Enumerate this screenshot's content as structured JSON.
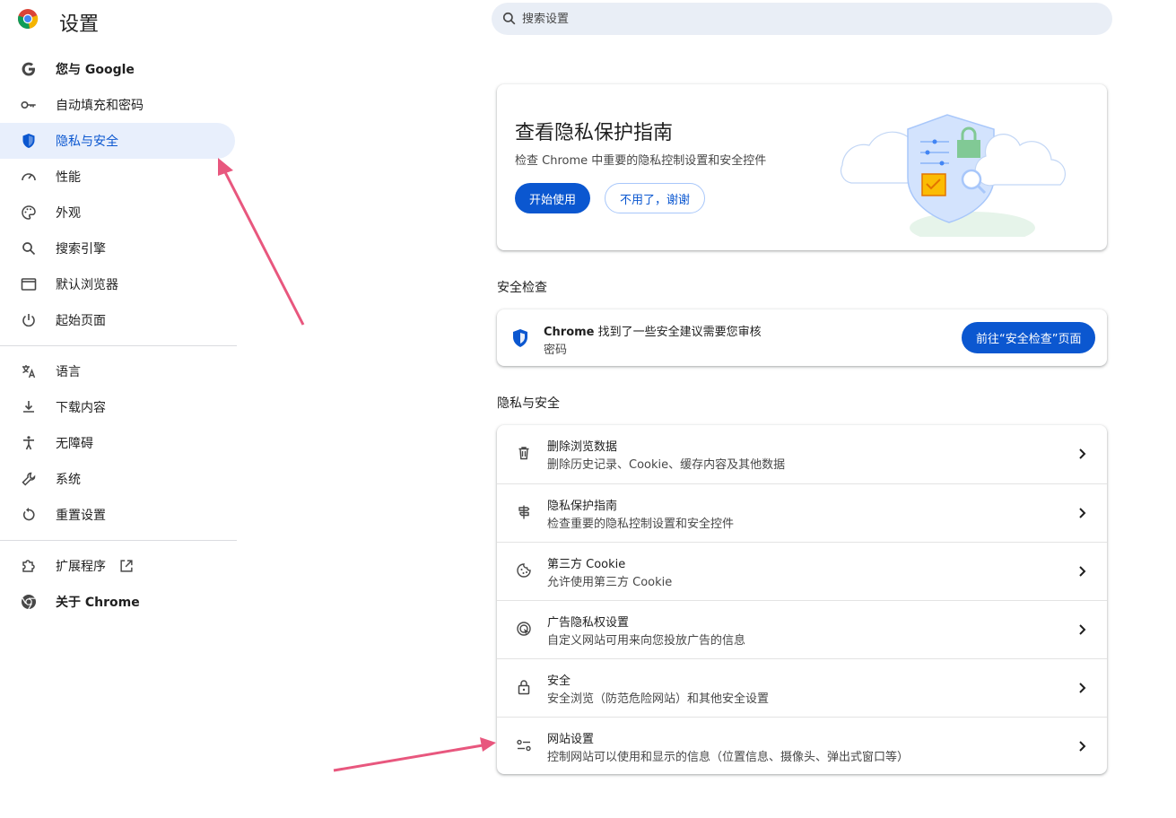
{
  "header": {
    "title": "设置",
    "search_placeholder": "搜索设置"
  },
  "sidebar": {
    "items": [
      {
        "label": "您与 Google",
        "icon": "google-icon"
      },
      {
        "label": "自动填充和密码",
        "icon": "key-icon"
      },
      {
        "label": "隐私与安全",
        "icon": "shield-icon",
        "active": true
      },
      {
        "label": "性能",
        "icon": "speedometer-icon"
      },
      {
        "label": "外观",
        "icon": "palette-icon"
      },
      {
        "label": "搜索引擎",
        "icon": "search-icon"
      },
      {
        "label": "默认浏览器",
        "icon": "browser-window-icon"
      },
      {
        "label": "起始页面",
        "icon": "power-icon"
      }
    ],
    "items2": [
      {
        "label": "语言",
        "icon": "translate-icon"
      },
      {
        "label": "下载内容",
        "icon": "download-icon"
      },
      {
        "label": "无障碍",
        "icon": "accessibility-icon"
      },
      {
        "label": "系统",
        "icon": "wrench-icon"
      },
      {
        "label": "重置设置",
        "icon": "reset-icon"
      }
    ],
    "items3": [
      {
        "label": "扩展程序",
        "icon": "puzzle-icon"
      },
      {
        "label": "关于 Chrome",
        "icon": "chrome-icon"
      }
    ]
  },
  "promo": {
    "title": "查看隐私保护指南",
    "subtitle": "检查 Chrome 中重要的隐私控制设置和安全控件",
    "start_label": "开始使用",
    "dismiss_label": "不用了，谢谢"
  },
  "safety_check": {
    "section_title": "安全检查",
    "line1_brand": "Chrome",
    "line1_rest": " 找到了一些安全建议需要您审核",
    "line2": "密码",
    "button_label": "前往“安全检查”页面"
  },
  "privacy": {
    "section_title": "隐私与安全",
    "rows": [
      {
        "title": "删除浏览数据",
        "subtitle": "删除历史记录、Cookie、缓存内容及其他数据",
        "icon": "trash-icon"
      },
      {
        "title": "隐私保护指南",
        "subtitle": "检查重要的隐私控制设置和安全控件",
        "icon": "guide-icon"
      },
      {
        "title": "第三方 Cookie",
        "subtitle": "允许使用第三方 Cookie",
        "icon": "cookie-icon"
      },
      {
        "title": "广告隐私权设置",
        "subtitle": "自定义网站可用来向您投放广告的信息",
        "icon": "ad-privacy-icon"
      },
      {
        "title": "安全",
        "subtitle": "安全浏览（防范危险网站）和其他安全设置",
        "icon": "lock-icon"
      },
      {
        "title": "网站设置",
        "subtitle": "控制网站可以使用和显示的信息（位置信息、摄像头、弹出式窗口等）",
        "icon": "tune-icon"
      }
    ]
  },
  "colors": {
    "accent": "#0b57d0",
    "active_bg": "#e8effc",
    "annotation_arrow": "#e8577e"
  }
}
